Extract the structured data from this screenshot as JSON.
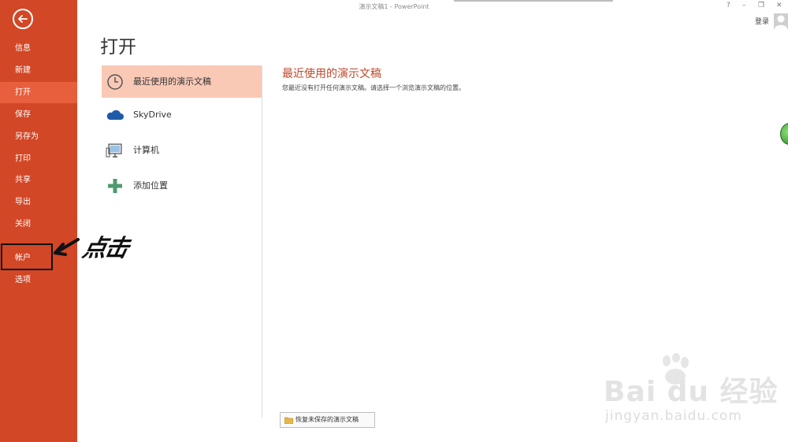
{
  "window": {
    "title": "演示文稿1 - PowerPoint",
    "help": "?",
    "minimize": "–",
    "restore": "❐",
    "close": "✕",
    "login": "登录"
  },
  "sidebar": {
    "items": [
      {
        "label": "信息"
      },
      {
        "label": "新建"
      },
      {
        "label": "打开"
      },
      {
        "label": "保存"
      },
      {
        "label": "另存为"
      },
      {
        "label": "打印"
      },
      {
        "label": "共享"
      },
      {
        "label": "导出"
      },
      {
        "label": "关闭"
      },
      {
        "label": "帐户"
      },
      {
        "label": "选项"
      }
    ],
    "active": "打开"
  },
  "annotation": {
    "text": "点击"
  },
  "main": {
    "title": "打开",
    "places": [
      {
        "label": "最近使用的演示文稿",
        "icon": "clock-icon"
      },
      {
        "label": "SkyDrive",
        "icon": "cloud-icon"
      },
      {
        "label": "计算机",
        "icon": "computer-icon"
      },
      {
        "label": "添加位置",
        "icon": "plus-icon"
      }
    ],
    "content_heading": "最近使用的演示文稿",
    "content_desc": "您最近没有打开任何演示文稿。请选择一个浏览演示文稿的位置。",
    "recover_button": "恢复未保存的演示文稿"
  },
  "watermark": {
    "logo": "Bai du 经验",
    "url": "jingyan.baidu.com"
  },
  "colors": {
    "accent": "#d24726",
    "active_nav": "#e85f3d",
    "selected_place": "#f9c9b6",
    "heading": "#c0472a"
  }
}
